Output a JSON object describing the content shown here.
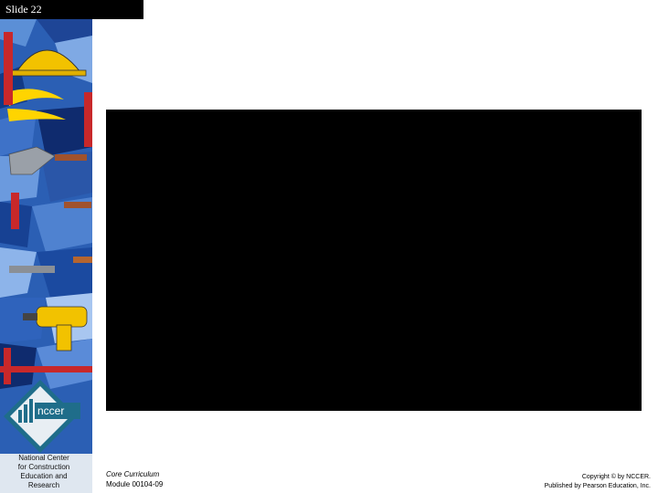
{
  "slide": {
    "label": "Slide 22"
  },
  "sidebar": {
    "logo_text": "nccer",
    "org_lines": [
      "National Center",
      "for Construction",
      "Education and",
      "Research"
    ]
  },
  "footer": {
    "course": "Core Curriculum",
    "module": "Module 00104-09",
    "copyright_line1": "Copyright © by NCCER.",
    "copyright_line2": "Published by Pearson Education, Inc."
  },
  "colors": {
    "tile_blue": "#2b5fb4",
    "tile_dark": "#0f2b6e",
    "accent_yellow": "#f2c200",
    "accent_red": "#c8282a",
    "logo_teal": "#1f6d8a"
  }
}
